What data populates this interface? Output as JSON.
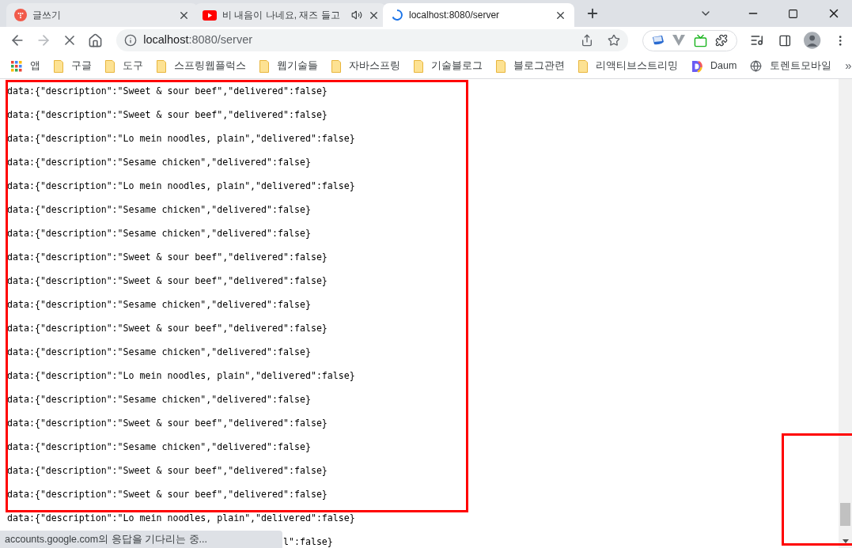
{
  "tabs": [
    {
      "title": "글쓰기",
      "kind": "blog",
      "selected": false,
      "audio": false,
      "loading": false
    },
    {
      "title": "비 내음이 나네요, 재즈 들고",
      "kind": "video",
      "selected": false,
      "audio": true,
      "loading": false
    },
    {
      "title": "localhost:8080/server",
      "kind": "page",
      "selected": true,
      "audio": false,
      "loading": true
    }
  ],
  "nav_buttons": [
    {
      "kind": "back",
      "disabled": false
    },
    {
      "kind": "forward",
      "disabled": true
    },
    {
      "kind": "stop",
      "disabled": false
    },
    {
      "kind": "home",
      "disabled": false
    }
  ],
  "address_bar": {
    "host": "localhost",
    "rest": ":8080/server"
  },
  "bookmarks": [
    {
      "kind": "apps",
      "label": "앱"
    },
    {
      "kind": "folder",
      "label": "구글"
    },
    {
      "kind": "folder",
      "label": "도구"
    },
    {
      "kind": "folder",
      "label": "스프링웹플럭스"
    },
    {
      "kind": "folder",
      "label": "웹기술들"
    },
    {
      "kind": "folder",
      "label": "자바스프링"
    },
    {
      "kind": "folder",
      "label": "기술블로그"
    },
    {
      "kind": "folder",
      "label": "블로그관련"
    },
    {
      "kind": "folder",
      "label": "리액티브스트리밍"
    },
    {
      "kind": "daum",
      "label": "Daum"
    },
    {
      "kind": "site",
      "label": "토렌트모바일"
    }
  ],
  "bookmarks_more": "»",
  "lines": [
    {
      "kind": "full",
      "text": "data:{\"description\":\"Sweet & sour beef\",\"delivered\":false}"
    },
    {
      "kind": "full",
      "text": "data:{\"description\":\"Sweet & sour beef\",\"delivered\":false}"
    },
    {
      "kind": "full",
      "text": "data:{\"description\":\"Lo mein noodles, plain\",\"delivered\":false}"
    },
    {
      "kind": "full",
      "text": "data:{\"description\":\"Sesame chicken\",\"delivered\":false}"
    },
    {
      "kind": "full",
      "text": "data:{\"description\":\"Lo mein noodles, plain\",\"delivered\":false}"
    },
    {
      "kind": "full",
      "text": "data:{\"description\":\"Sesame chicken\",\"delivered\":false}"
    },
    {
      "kind": "full",
      "text": "data:{\"description\":\"Sesame chicken\",\"delivered\":false}"
    },
    {
      "kind": "full",
      "text": "data:{\"description\":\"Sweet & sour beef\",\"delivered\":false}"
    },
    {
      "kind": "full",
      "text": "data:{\"description\":\"Sweet & sour beef\",\"delivered\":false}"
    },
    {
      "kind": "full",
      "text": "data:{\"description\":\"Sesame chicken\",\"delivered\":false}"
    },
    {
      "kind": "full",
      "text": "data:{\"description\":\"Sweet & sour beef\",\"delivered\":false}"
    },
    {
      "kind": "full",
      "text": "data:{\"description\":\"Sesame chicken\",\"delivered\":false}"
    },
    {
      "kind": "full",
      "text": "data:{\"description\":\"Lo mein noodles, plain\",\"delivered\":false}"
    },
    {
      "kind": "full",
      "text": "data:{\"description\":\"Sesame chicken\",\"delivered\":false}"
    },
    {
      "kind": "full",
      "text": "data:{\"description\":\"Sweet & sour beef\",\"delivered\":false}"
    },
    {
      "kind": "full",
      "text": "data:{\"description\":\"Sesame chicken\",\"delivered\":false}"
    },
    {
      "kind": "full",
      "text": "data:{\"description\":\"Sweet & sour beef\",\"delivered\":false}"
    },
    {
      "kind": "full",
      "text": "data:{\"description\":\"Sweet & sour beef\",\"delivered\":false}"
    },
    {
      "kind": "full",
      "text": "data:{\"description\":\"Lo mein noodles, plain\",\"delivered\":false}"
    },
    {
      "kind": "tail",
      "text": "l\":false}"
    }
  ],
  "status_bubble": "accounts.google.com의 응답을 기다리는 중..."
}
